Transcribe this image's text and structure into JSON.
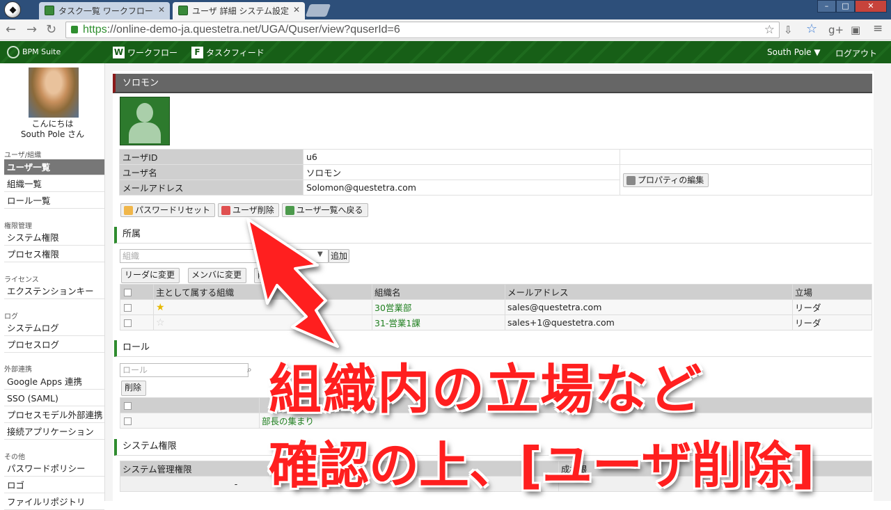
{
  "browser": {
    "tabs": [
      {
        "label": "タスク一覧 ワークフロー"
      },
      {
        "label": "ユーザ 詳細 システム設定"
      }
    ],
    "url_scheme": "https",
    "url_rest": "://online-demo-ja.questetra.net/UGA/Quser/view?quserId=6"
  },
  "appbar": {
    "logo": "BPM Suite",
    "nav": [
      {
        "icon": "W",
        "label": "ワークフロー"
      },
      {
        "icon": "F",
        "label": "タスクフィード"
      }
    ],
    "user_menu": "South Pole ▼",
    "logout": "ログアウト"
  },
  "sidebar": {
    "greeting1": "こんにちは",
    "greeting2": "South Pole さん",
    "groups": [
      {
        "label": "ユーザ/組織",
        "items": [
          "ユーザ一覧",
          "組織一覧",
          "ロール一覧"
        ]
      },
      {
        "label": "権限管理",
        "items": [
          "システム権限",
          "プロセス権限"
        ]
      },
      {
        "label": "ライセンス",
        "items": [
          "エクステンションキー"
        ]
      },
      {
        "label": "ログ",
        "items": [
          "システムログ",
          "プロセスログ"
        ]
      },
      {
        "label": "外部連携",
        "items": [
          "Google Apps 連携",
          "SSO (SAML)",
          "プロセスモデル外部連携",
          "接続アプリケーション"
        ]
      },
      {
        "label": "その他",
        "items": [
          "パスワードポリシー",
          "ロゴ",
          "ファイルリポジトリ"
        ]
      }
    ]
  },
  "user": {
    "title": "ソロモン",
    "fields": [
      {
        "key": "ユーザID",
        "value": "u6"
      },
      {
        "key": "ユーザ名",
        "value": "ソロモン"
      },
      {
        "key": "メールアドレス",
        "value": "Solomon@questetra.com"
      }
    ],
    "edit_props": "プロパティの編集"
  },
  "actions": {
    "reset_password": "パスワードリセット",
    "delete_user": "ユーザ削除",
    "back_to_list": "ユーザ一覧へ戻る"
  },
  "affiliation": {
    "title": "所属",
    "org_placeholder": "組織",
    "add": "追加",
    "to_leader": "リーダに変更",
    "to_member": "メンバに変更",
    "delete_partial": "削",
    "headers": [
      "主として属する組織",
      "組織名",
      "メールアドレス",
      "立場"
    ],
    "rows": [
      {
        "primary": "★",
        "org": "30営業部",
        "email": "sales@questetra.com",
        "position": "リーダ"
      },
      {
        "primary": "☆",
        "org": "31-営業1課",
        "email": "sales+1@questetra.com",
        "position": "リーダ"
      }
    ]
  },
  "roles": {
    "title": "ロール",
    "placeholder": "ロール",
    "delete": "削除",
    "rows": [
      "部長の集まり"
    ]
  },
  "system_perm": {
    "title": "システム権限",
    "col1": "システム管理権限",
    "col2_partial": "成権限",
    "cell1": "-"
  },
  "overlay": {
    "line1": "組織内の立場など",
    "line2": "確認の上、[ユーザ削除]"
  },
  "colors": {
    "accent_red": "#ff1f1f",
    "app_green": "#155c15"
  }
}
